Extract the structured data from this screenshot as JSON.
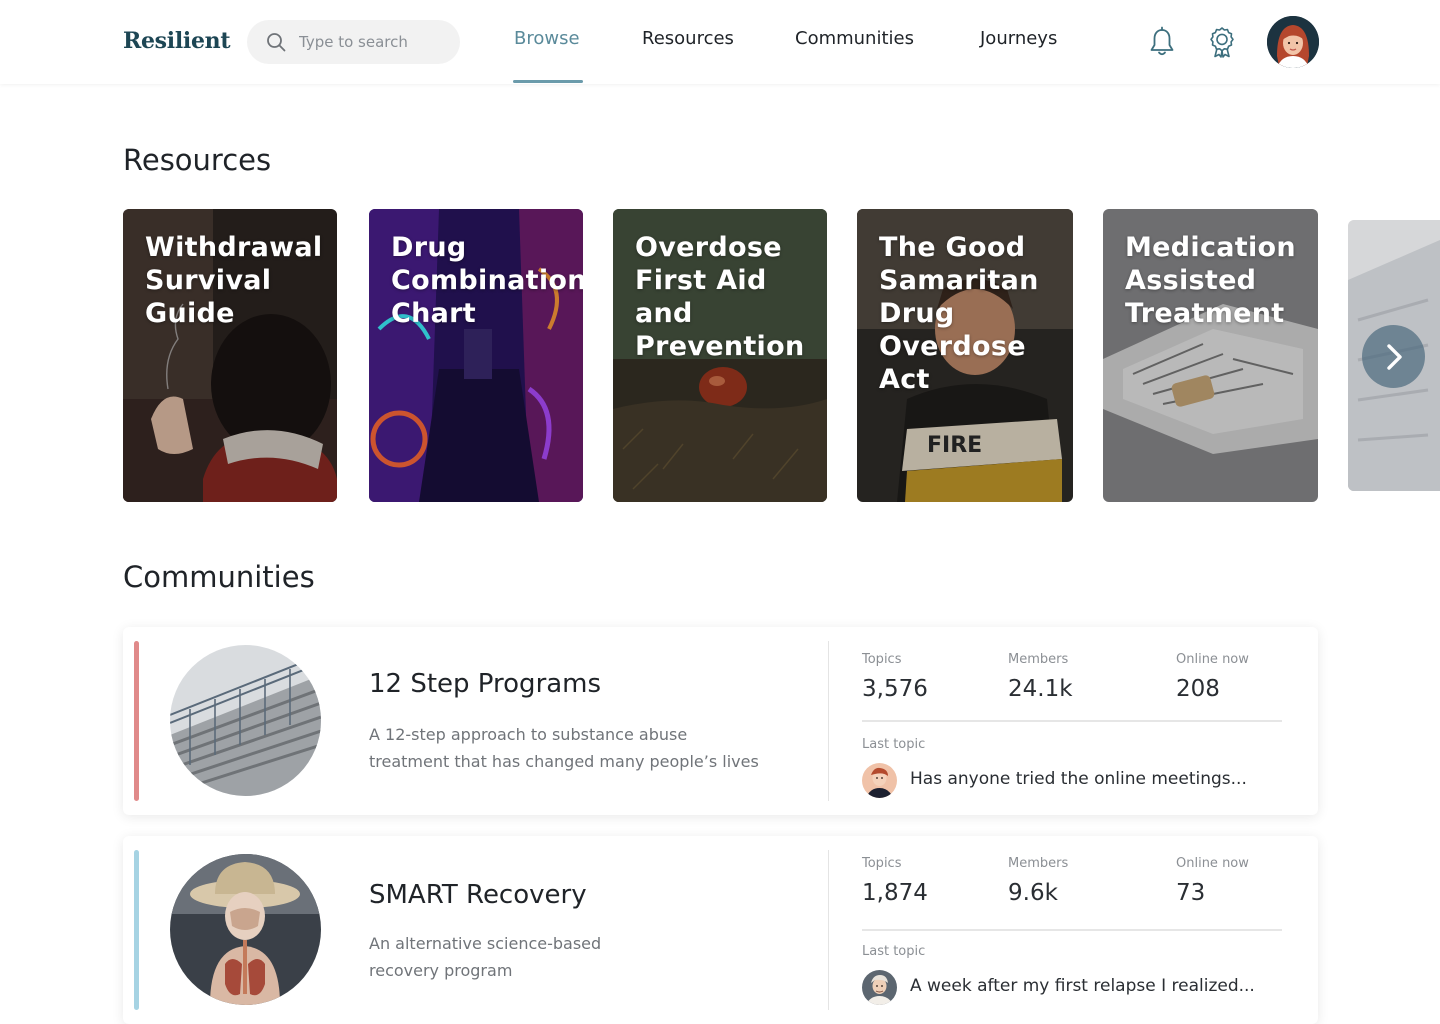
{
  "app": {
    "logo": "Resilient"
  },
  "search": {
    "placeholder": "Type to search",
    "value": ""
  },
  "nav": {
    "tabs": [
      {
        "label": "Browse",
        "active": true
      },
      {
        "label": "Resources",
        "active": false
      },
      {
        "label": "Communities",
        "active": false
      },
      {
        "label": "Journeys",
        "active": false
      }
    ]
  },
  "header_icons": [
    "bell-icon",
    "award-badge-icon",
    "user-avatar"
  ],
  "colors": {
    "accent": "#6b9bab",
    "logo": "#1d4654",
    "community_1_accent": "#e08a8a",
    "community_2_accent": "#a6d3e3"
  },
  "resources": {
    "title": "Resources",
    "cards": [
      {
        "title": "Withdrawal Survival Guide"
      },
      {
        "title": "Drug Combination Chart"
      },
      {
        "title": "Overdose First Aid and Prevention"
      },
      {
        "title": "The Good Samaritan Drug Overdose Act"
      },
      {
        "title": "Medication Assisted Treatment"
      }
    ],
    "next_icon": "chevron-right-icon"
  },
  "communities": {
    "title": "Communities",
    "items": [
      {
        "name": "12 Step Programs",
        "description": "A 12-step approach to substance abuse treatment that has changed many people’s lives",
        "topics_label": "Topics",
        "topics": "3,576",
        "members_label": "Members",
        "members": "24.1k",
        "online_label": "Online now",
        "online": "208",
        "last_topic_label": "Last topic",
        "last_topic": "Has anyone tried the online meetings..."
      },
      {
        "name": "SMART Recovery",
        "description": "An alternative science-based recovery program",
        "topics_label": "Topics",
        "topics": "1,874",
        "members_label": "Members",
        "members": "9.6k",
        "online_label": "Online now",
        "online": "73",
        "last_topic_label": "Last topic",
        "last_topic": "A week after my first relapse I realized..."
      }
    ]
  }
}
